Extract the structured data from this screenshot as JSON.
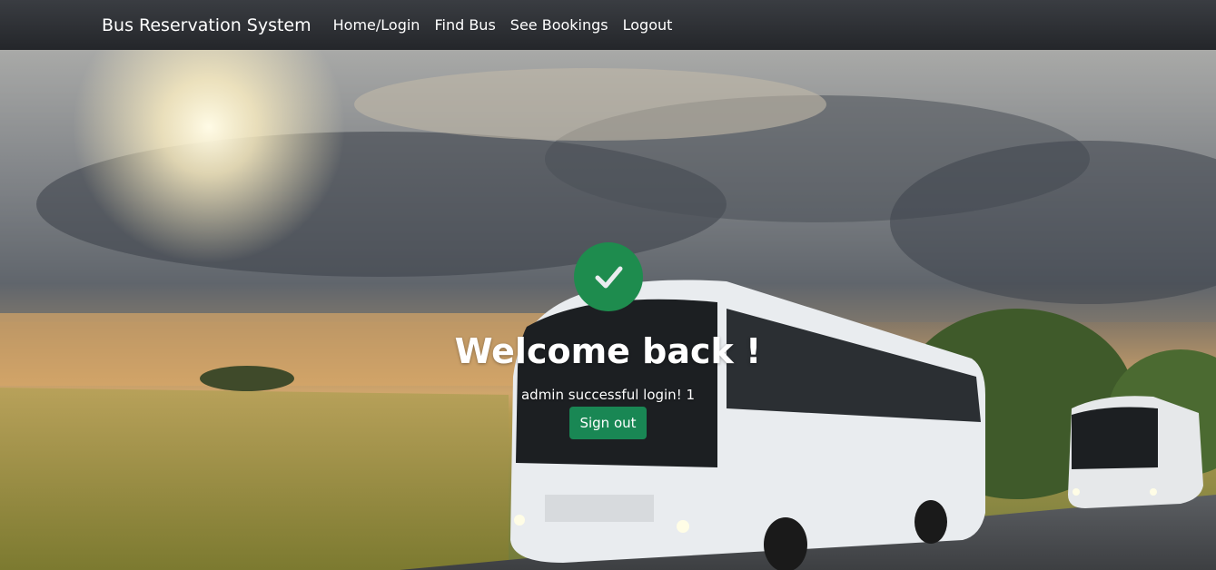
{
  "nav": {
    "brand": "Bus Reservation System",
    "links": [
      "Home/Login",
      "Find Bus",
      "See Bookings",
      "Logout"
    ]
  },
  "welcome": {
    "title": "Welcome back !",
    "message": "admin successful login! 1",
    "signout_label": "Sign out",
    "icon": "check-icon"
  },
  "colors": {
    "navbar": "#2b2d31",
    "success": "#198754"
  }
}
